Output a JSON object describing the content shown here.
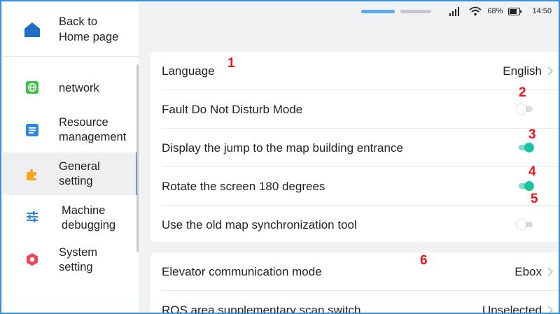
{
  "status_bar": {
    "signal_icon": "signal-bars-icon",
    "wifi_icon": "wifi-icon",
    "battery_percent": "68%",
    "battery_icon": "battery-icon",
    "time": "14:50"
  },
  "sidebar": {
    "back": {
      "label_line1": "Back to",
      "label_line2": "Home page",
      "icon": "home-icon",
      "icon_color": "#1f6fc9"
    },
    "items": [
      {
        "id": "network",
        "line1": "network",
        "line2": "",
        "icon": "globe-icon",
        "icon_color": "#3cbf4a",
        "active": false
      },
      {
        "id": "resource",
        "line1": "Resource",
        "line2": "management",
        "icon": "document-icon",
        "icon_color": "#2f86e0",
        "active": false
      },
      {
        "id": "general",
        "line1": "General",
        "line2": "setting",
        "icon": "puzzle-icon",
        "icon_color": "#f5a623",
        "active": true
      },
      {
        "id": "machine",
        "line1": "Machine",
        "line2": "debugging",
        "icon": "sliders-icon",
        "icon_color": "#2f86e0",
        "active": false
      },
      {
        "id": "system",
        "line1": "System",
        "line2": "setting",
        "icon": "hexagon-icon",
        "icon_color": "#f0455a",
        "active": false
      }
    ]
  },
  "settings": {
    "card1": [
      {
        "label": "Language",
        "type": "select",
        "value": "English"
      },
      {
        "label": "Fault Do Not Disturb Mode",
        "type": "toggle",
        "on": false
      },
      {
        "label": "Display the jump to the map building entrance",
        "type": "toggle",
        "on": true
      },
      {
        "label": "Rotate the screen 180 degrees",
        "type": "toggle",
        "on": true
      },
      {
        "label": "Use the old map synchronization tool",
        "type": "toggle",
        "on": false
      }
    ],
    "card2": [
      {
        "label": "Elevator communication mode",
        "type": "select",
        "value": "Ebox"
      },
      {
        "label": "ROS area supplementary scan switch",
        "type": "select",
        "value": "Unselected"
      }
    ]
  },
  "annotations": [
    "1",
    "2",
    "3",
    "4",
    "5",
    "6"
  ],
  "colors": {
    "accent": "#1f6fc9",
    "toggle_on": "#18c4a3",
    "annotation": "#e8141b"
  }
}
